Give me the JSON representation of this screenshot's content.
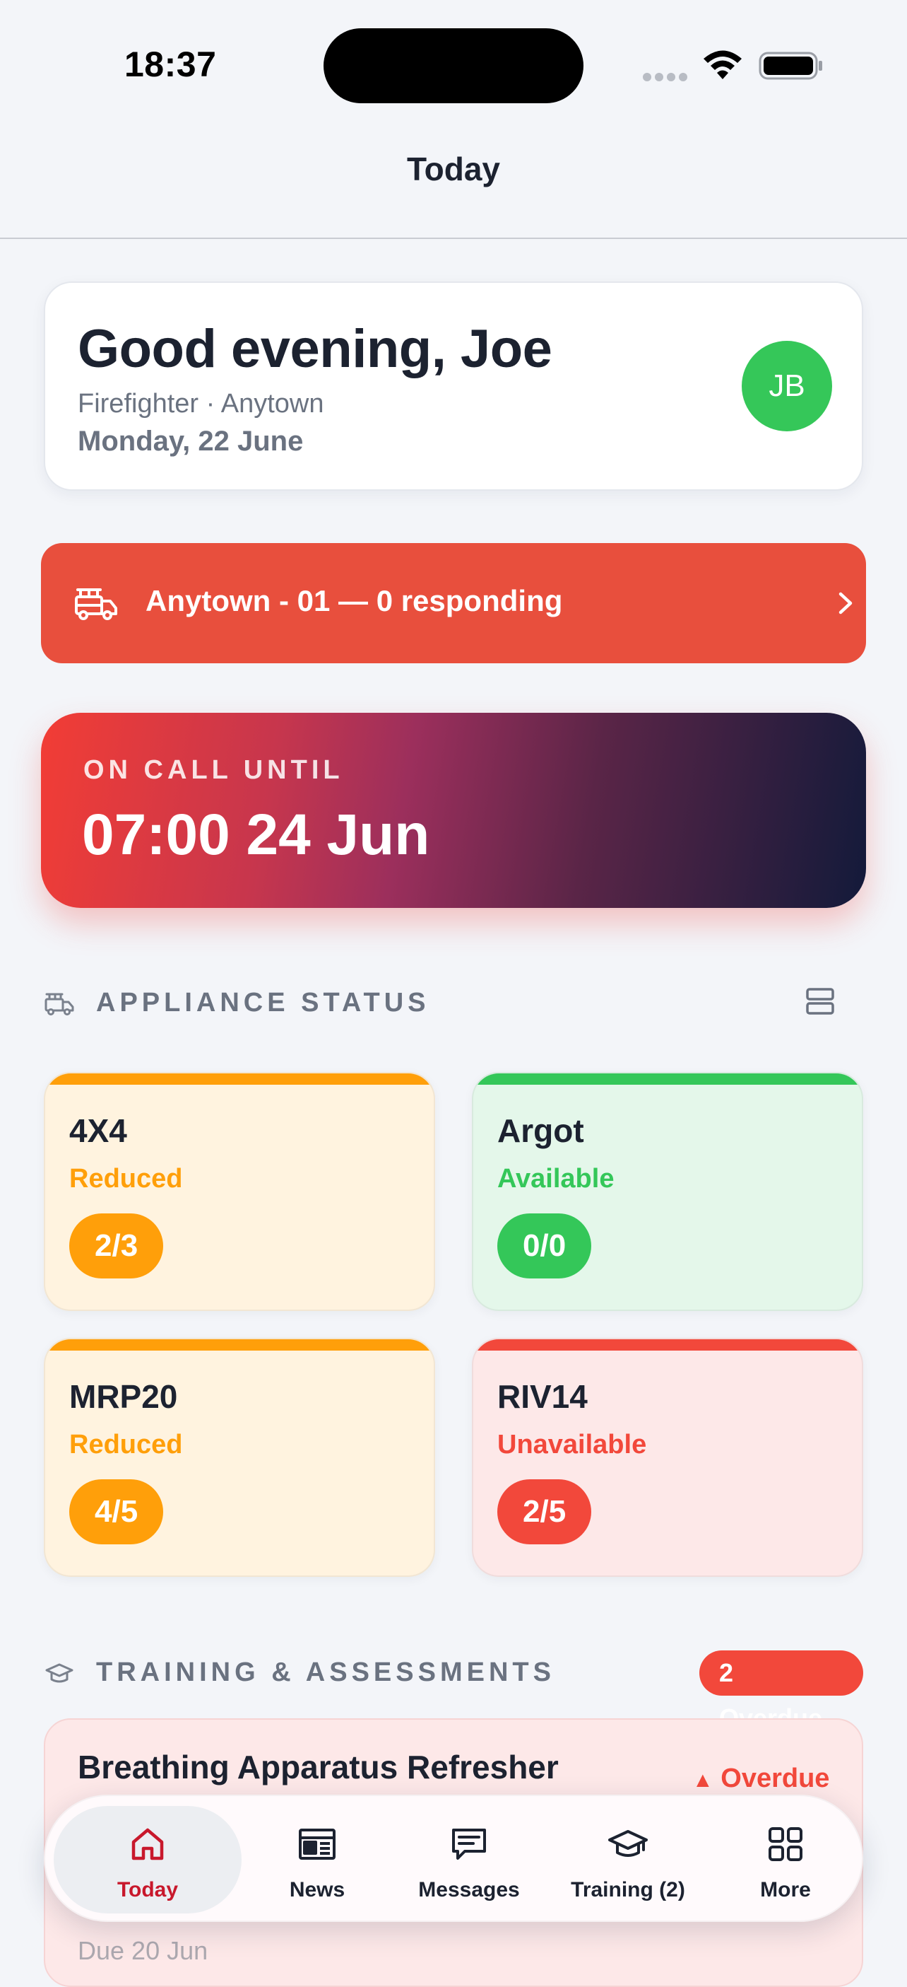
{
  "status_bar": {
    "time": "18:37"
  },
  "nav": {
    "title": "Today"
  },
  "greeting": {
    "title": "Good evening, Joe",
    "role": "Firefighter · Anytown",
    "date": "Monday, 22 June",
    "avatar_initials": "JB",
    "avatar_color": "#35c759"
  },
  "incident": {
    "text": "Anytown - 01 — 0 responding",
    "color": "#e84f3d",
    "icon": "fire-truck-icon"
  },
  "on_call": {
    "label": "ON CALL UNTIL",
    "value": "07:00 24 Jun"
  },
  "appliance_section": {
    "title": "APPLIANCE STATUS",
    "icon": "fire-truck-icon",
    "toggle_icon": "layout-toggle-icon"
  },
  "appliances": [
    {
      "name": "4X4",
      "status": "Reduced",
      "crew": "2/3",
      "color": "#ff9f0a",
      "bg": "#fff3df"
    },
    {
      "name": "Argot",
      "status": "Available",
      "crew": "0/0",
      "color": "#34c759",
      "bg": "#e4f7ea"
    },
    {
      "name": "MRP20",
      "status": "Reduced",
      "crew": "4/5",
      "color": "#ff9f0a",
      "bg": "#fff3df"
    },
    {
      "name": "RIV14",
      "status": "Unavailable",
      "crew": "2/5",
      "color": "#f2483b",
      "bg": "#fde8e8"
    }
  ],
  "training_section": {
    "title": "TRAINING & ASSESSMENTS",
    "badge": "2 Overdue",
    "icon": "graduation-cap-icon"
  },
  "training_item": {
    "title": "Breathing Apparatus Refresher",
    "status": "Overdue",
    "status_icon": "warning-triangle-icon",
    "due": "Due 20 Jun"
  },
  "tabs": [
    {
      "label": "Today",
      "icon": "home-icon",
      "active": true
    },
    {
      "label": "News",
      "icon": "newspaper-icon",
      "active": false
    },
    {
      "label": "Messages",
      "icon": "message-icon",
      "active": false
    },
    {
      "label": "Training (2)",
      "icon": "graduation-cap-icon",
      "active": false
    },
    {
      "label": "More",
      "icon": "grid-icon",
      "active": false
    }
  ],
  "colors": {
    "accent": "#c8182c",
    "reduced": "#ff9f0a",
    "available": "#34c759",
    "unavailable": "#f2483b"
  }
}
